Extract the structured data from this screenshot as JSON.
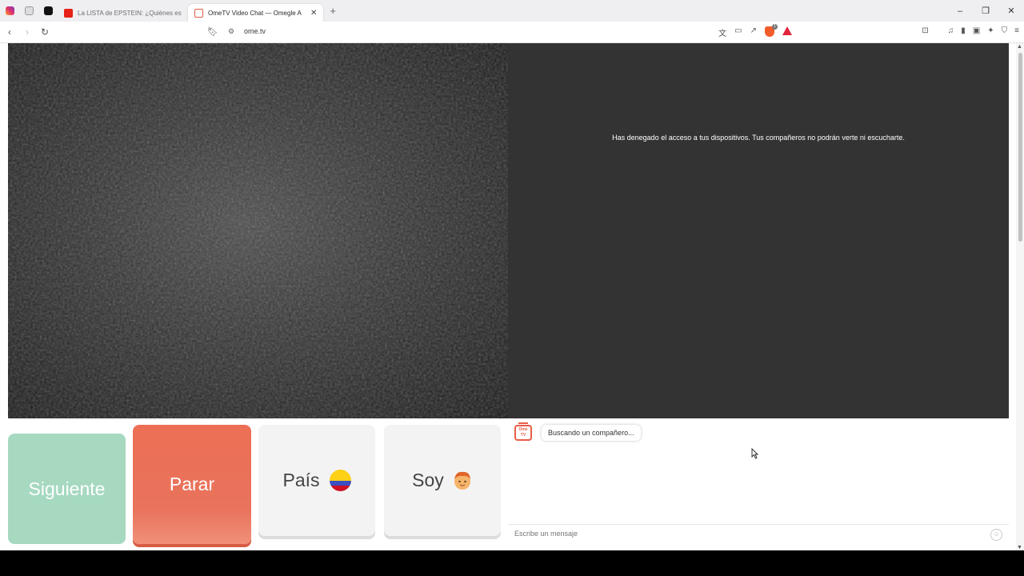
{
  "browser": {
    "tabs": [
      {
        "title": "La LISTA de EPSTEIN: ¿Quiénes están",
        "active": false,
        "favicon_color": "#e62117"
      },
      {
        "title": "OmeTV Video Chat — Omegle A",
        "active": true,
        "favicon_color": "#e85c48"
      }
    ],
    "pinned_icons": [
      "instagram-icon",
      "app-icon",
      "tiktok-icon"
    ],
    "url": "ome.tv",
    "shield_count": "1"
  },
  "page": {
    "denied_message": "Has denegado el acceso a tus dispositivos. Tus compañeros no podrán verte ni escucharte.",
    "buttons": {
      "next": "Siguiente",
      "stop": "Parar",
      "country": "País",
      "gender": "Soy"
    },
    "chat": {
      "logo_text": "Ome TV",
      "searching": "Buscando un compañero...",
      "placeholder": "Escribe un mensaje"
    }
  }
}
